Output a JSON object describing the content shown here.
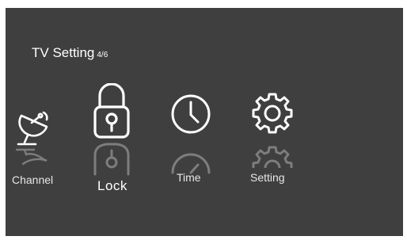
{
  "header": {
    "title": "TV Setting",
    "page_indicator": "4/6"
  },
  "menu": {
    "selected": "Lock",
    "items": [
      {
        "label": "Channel",
        "icon": "satellite-dish-icon"
      },
      {
        "label": "Lock",
        "icon": "padlock-icon"
      },
      {
        "label": "Time",
        "icon": "clock-icon"
      },
      {
        "label": "Setting",
        "icon": "gear-icon"
      }
    ]
  },
  "colors": {
    "background": "#3f3f3f",
    "text": "#ffffff"
  }
}
